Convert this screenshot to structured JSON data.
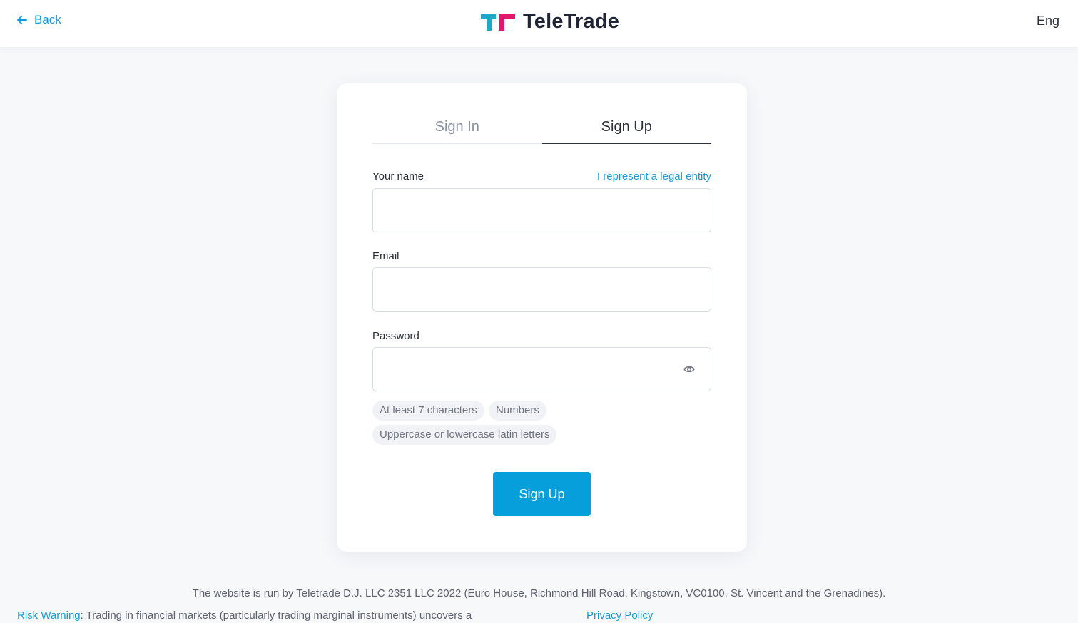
{
  "header": {
    "back_label": "Back",
    "brand": "TeleTrade",
    "language": "Eng",
    "colors": {
      "link": "#1a9bd7",
      "logo_teal": "#1fa9c9",
      "logo_pink": "#e2176b"
    }
  },
  "auth": {
    "tabs": [
      {
        "label": "Sign In",
        "active": false
      },
      {
        "label": "Sign Up",
        "active": true
      }
    ],
    "fields": {
      "name": {
        "label": "Your name",
        "value": "",
        "placeholder": ""
      },
      "email": {
        "label": "Email",
        "value": "",
        "placeholder": ""
      },
      "password": {
        "label": "Password",
        "value": "",
        "placeholder": ""
      }
    },
    "legal_entity_link": "I represent a legal entity",
    "password_rules": [
      "At least 7 characters",
      "Numbers",
      "Uppercase or lowercase latin letters"
    ],
    "submit_label": "Sign Up",
    "colors": {
      "primary": "#079fdb"
    }
  },
  "footer": {
    "company_info": "The website is run by Teletrade D.J. LLC 2351 LLC 2022 (Euro House, Richmond Hill Road, Kingstown, VC0100, St. Vincent and the Grenadines).",
    "risk_warning_label": "Risk Warning",
    "risk_warning_text": ": Trading in financial markets (particularly trading marginal instruments) uncovers a",
    "privacy_policy": "Privacy Policy"
  },
  "icons": {
    "back": "arrow-left-icon",
    "logo": "teletrade-logo-icon",
    "password_toggle": "eye-icon"
  }
}
